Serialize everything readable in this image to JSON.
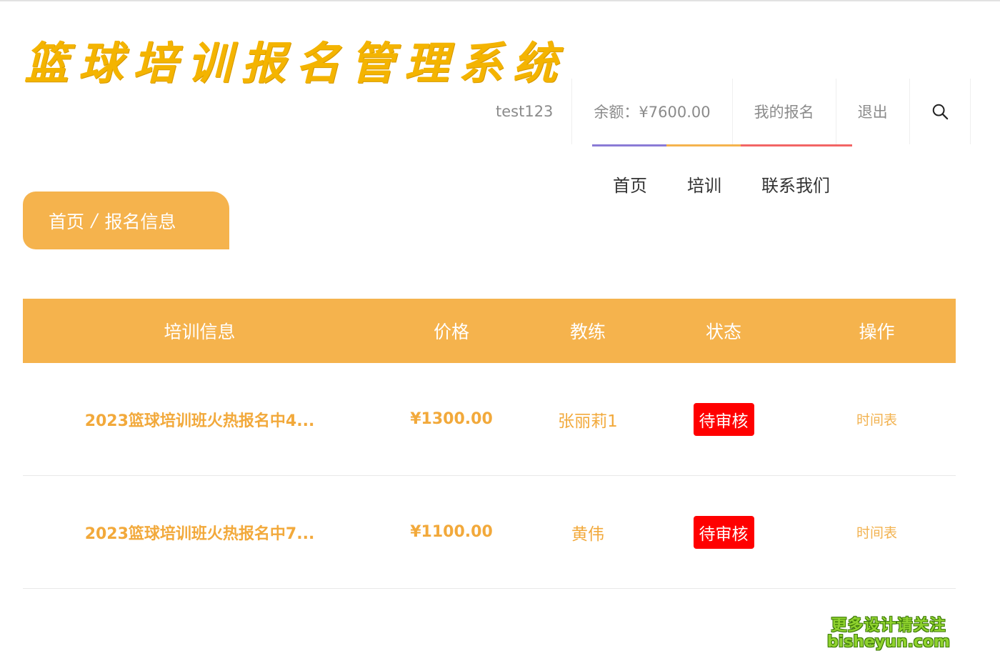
{
  "app": {
    "title": "篮球培训报名管理系统"
  },
  "header": {
    "username": "test123",
    "balance": "余额：¥7600.00",
    "my_signup": "我的报名",
    "logout": "退出",
    "search_icon": "search-icon",
    "accent_bars": [
      "#8a7bd6",
      "#f5b34d",
      "#f26565"
    ]
  },
  "nav": {
    "items": [
      {
        "label": "首页"
      },
      {
        "label": "培训"
      },
      {
        "label": "联系我们"
      }
    ]
  },
  "breadcrumb": {
    "home": "首页",
    "separator": "/",
    "current": "报名信息"
  },
  "table": {
    "headers": [
      "培训信息",
      "价格",
      "教练",
      "状态",
      "操作"
    ],
    "rows": [
      {
        "title": "2023篮球培训班火热报名中4...",
        "price": "¥1300.00",
        "coach": "张丽莉1",
        "status": "待审核",
        "action": "时间表"
      },
      {
        "title": "2023篮球培训班火热报名中7...",
        "price": "¥1100.00",
        "coach": "黄伟",
        "status": "待审核",
        "action": "时间表"
      }
    ]
  },
  "watermark": {
    "line1": "更多设计请关注",
    "line2": "bisheyun.com"
  },
  "colors": {
    "accent": "#f5b34d",
    "status_pending": "#ff0000",
    "logo": "#f4b400"
  }
}
